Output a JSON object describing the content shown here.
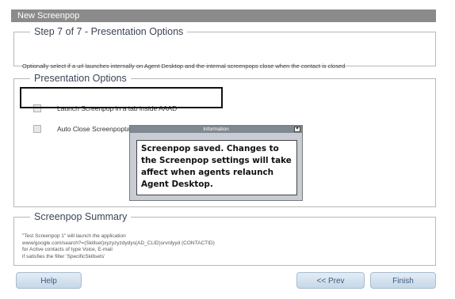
{
  "window": {
    "title": "New Screenpop"
  },
  "step": {
    "heading": "Step 7 of  7 - Presentation Options",
    "description": "Optionally  select  if a url launches  internally  on Agent Desktop  and the internal screenpops  close when the contact is closed"
  },
  "presentation_options": {
    "heading": "Presentation Options",
    "items": [
      {
        "label": "Launch Screenpop in a tab inside AAAD",
        "checked": false
      },
      {
        "label": "Auto Close Screenpoptab(s) on Work Item Release",
        "checked": false
      }
    ]
  },
  "summary": {
    "heading": "Screenpop Summary",
    "lines": [
      "\"Test Screenpop 1\" will launch the application",
      "www/google.com/search?=(Skillset)xyzyzyzdydys(AD_CLID)srvrdyyd (CONTACTID)",
      "for Active contacts of type Voice, E-mail",
      "if satisfies the filter 'SpecificSkillsets'"
    ]
  },
  "dialog": {
    "title": "Information",
    "close_glyph": "×",
    "message": "Screenpop saved. Changes to the Screenpop settings will take affect when agents relaunch Agent Desktop."
  },
  "buttons": {
    "help": "Help",
    "prev": "<< Prev",
    "finish": "Finish"
  }
}
